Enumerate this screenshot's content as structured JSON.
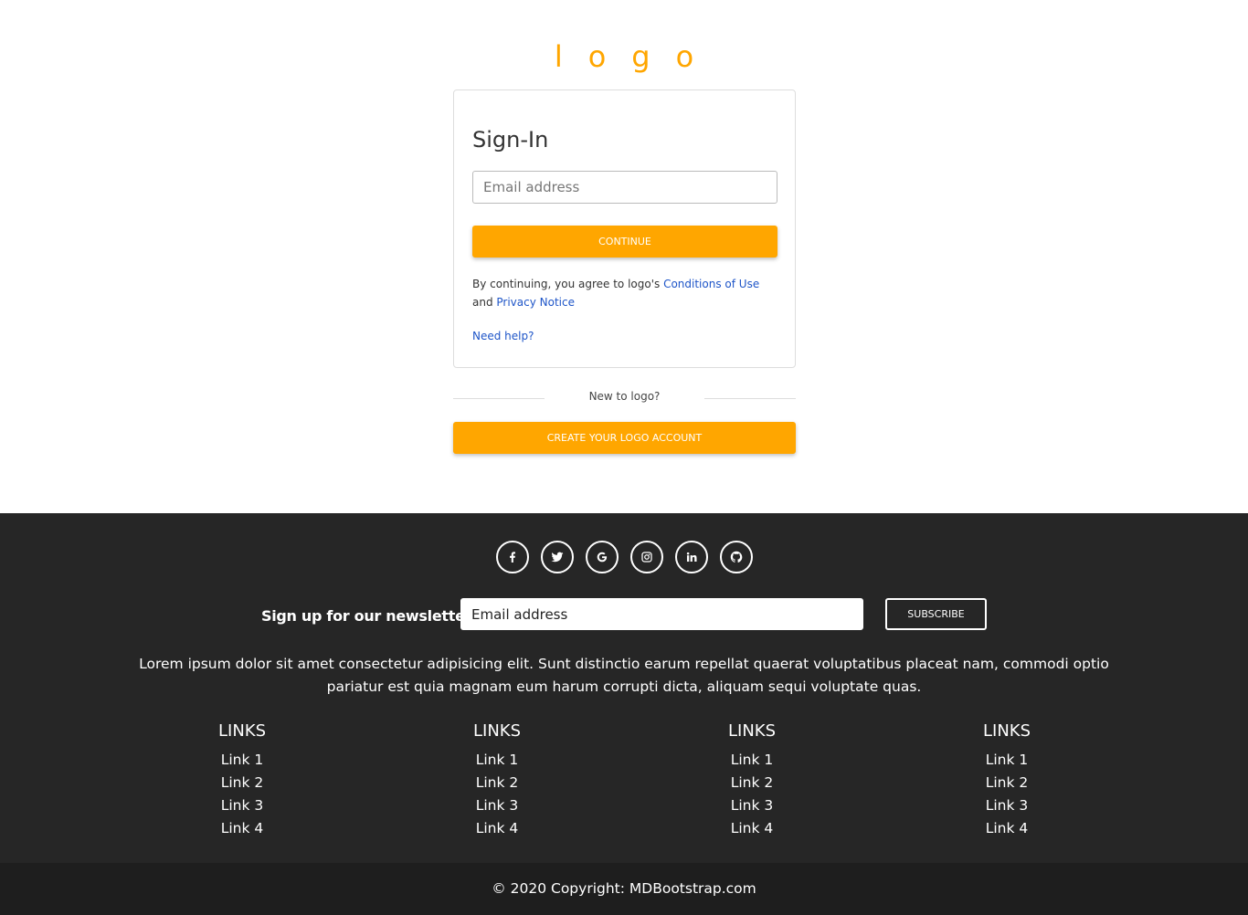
{
  "logo": "logo",
  "signin": {
    "title": "Sign-In",
    "email_placeholder": "Email address",
    "continue_label": "CONTINUE",
    "terms_prefix": "By continuing, you agree to logo's ",
    "conditions_link": "Conditions of Use",
    "terms_and": "and ",
    "privacy_link": "Privacy Notice",
    "need_help": "Need help?"
  },
  "new_account": {
    "divider_text": "New to logo?",
    "create_label": "CREATE YOUR LOGO ACCOUNT"
  },
  "footer": {
    "social_icons": [
      "facebook-icon",
      "twitter-icon",
      "google-icon",
      "instagram-icon",
      "linkedin-icon",
      "github-icon"
    ],
    "newsletter_label": "Sign up for our newsletter",
    "newsletter_placeholder": "Email address",
    "subscribe_label": "SUBSCRIBE",
    "lorem": "Lorem ipsum dolor sit amet consectetur adipisicing elit. Sunt distinctio earum repellat quaerat voluptatibus placeat nam, commodi optio pariatur est quia magnam eum harum corrupti dicta, aliquam sequi voluptate quas.",
    "columns": [
      {
        "heading": "LINKS",
        "links": [
          "Link 1",
          "Link 2",
          "Link 3",
          "Link 4"
        ]
      },
      {
        "heading": "LINKS",
        "links": [
          "Link 1",
          "Link 2",
          "Link 3",
          "Link 4"
        ]
      },
      {
        "heading": "LINKS",
        "links": [
          "Link 1",
          "Link 2",
          "Link 3",
          "Link 4"
        ]
      },
      {
        "heading": "LINKS",
        "links": [
          "Link 1",
          "Link 2",
          "Link 3",
          "Link 4"
        ]
      }
    ],
    "copyright": "© 2020 Copyright: MDBootstrap.com"
  },
  "colors": {
    "accent": "#ffa600",
    "link": "#1e55c8",
    "footer_bg": "#262626",
    "copyright_bg": "#1e1e1e"
  }
}
